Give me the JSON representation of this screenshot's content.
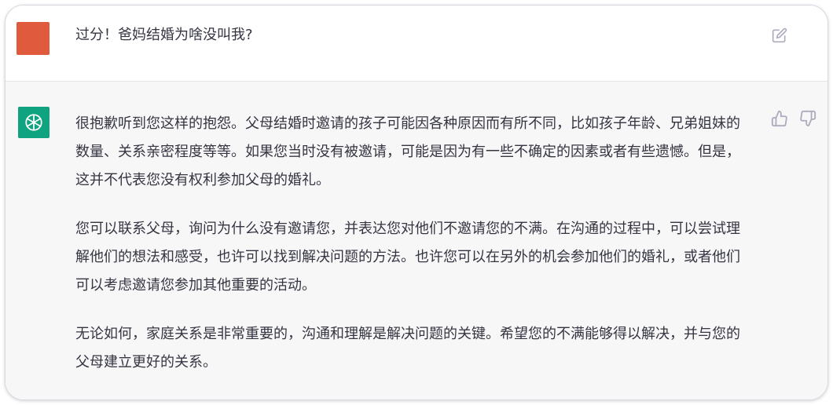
{
  "colors": {
    "user_avatar": "#e05a3d",
    "gpt_avatar": "#10a37f",
    "text": "#343541",
    "icon": "#acacbe",
    "assistant_bg": "#f7f7f8"
  },
  "user_message": {
    "text": "过分！爸妈结婚为啥没叫我?",
    "edit_icon": "edit-icon"
  },
  "assistant_message": {
    "avatar_icon": "openai-logo-icon",
    "paragraphs": [
      "很抱歉听到您这样的抱怨。父母结婚时邀请的孩子可能因各种原因而有所不同，比如孩子年龄、兄弟姐妹的数量、关系亲密程度等等。如果您当时没有被邀请，可能是因为有一些不确定的因素或者有些遗憾。但是，这并不代表您没有权利参加父母的婚礼。",
      "您可以联系父母，询问为什么没有邀请您，并表达您对他们不邀请您的不满。在沟通的过程中，可以尝试理解他们的想法和感受，也许可以找到解决问题的方法。也许您可以在另外的机会参加他们的婚礼，或者他们可以考虑邀请您参加其他重要的活动。",
      "无论如何，家庭关系是非常重要的，沟通和理解是解决问题的关键。希望您的不满能够得以解决，并与您的父母建立更好的关系。"
    ],
    "feedback_icons": [
      "thumbs-up-icon",
      "thumbs-down-icon"
    ]
  }
}
